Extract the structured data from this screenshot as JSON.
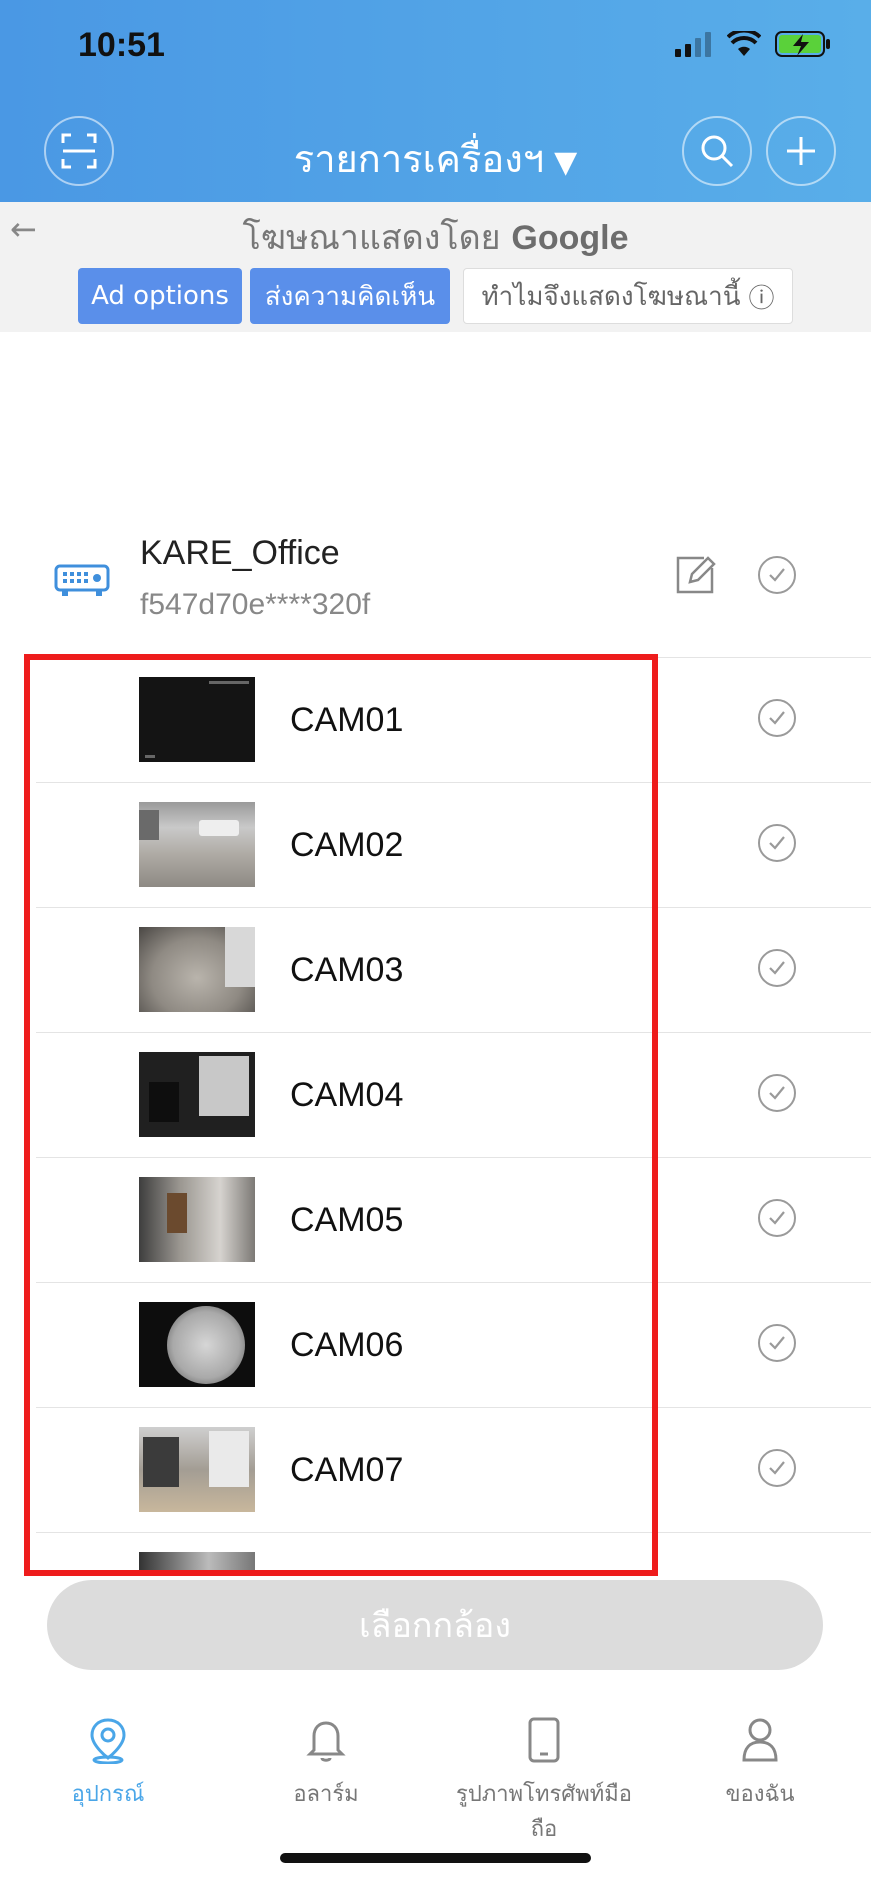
{
  "status_bar": {
    "time": "10:51"
  },
  "header": {
    "title": "รายการเครื่องฯ",
    "dropdown_glyph": "▼"
  },
  "ad": {
    "attribution": "โฆษณาแสดงโดย",
    "brand": "Google",
    "options_label": "Ad options",
    "feedback_label": "ส่งความคิดเห็น",
    "why_label": "ทำไมจึงแสดงโฆษณานี้",
    "info_glyph": "ⓘ",
    "back_glyph": "←"
  },
  "device": {
    "name": "KARE_Office",
    "id": "f547d70e****320f"
  },
  "cameras": [
    {
      "label": "CAM01"
    },
    {
      "label": "CAM02"
    },
    {
      "label": "CAM03"
    },
    {
      "label": "CAM04"
    },
    {
      "label": "CAM05"
    },
    {
      "label": "CAM06"
    },
    {
      "label": "CAM07"
    }
  ],
  "select_button": {
    "label": "เลือกกล้อง"
  },
  "tabs": [
    {
      "label": "อุปกรณ์",
      "icon": "location-pin-icon",
      "active": true
    },
    {
      "label": "อลาร์ม",
      "icon": "bell-icon",
      "active": false
    },
    {
      "label": "รูปภาพโทรศัพท์มือถือ",
      "icon": "tablet-icon",
      "active": false
    },
    {
      "label": "ของฉัน",
      "icon": "person-icon",
      "active": false
    }
  ],
  "colors": {
    "accent": "#4aa6e8",
    "header": "#4a98e4",
    "highlight": "#ee1c1c",
    "battery": "#5ad13a"
  }
}
